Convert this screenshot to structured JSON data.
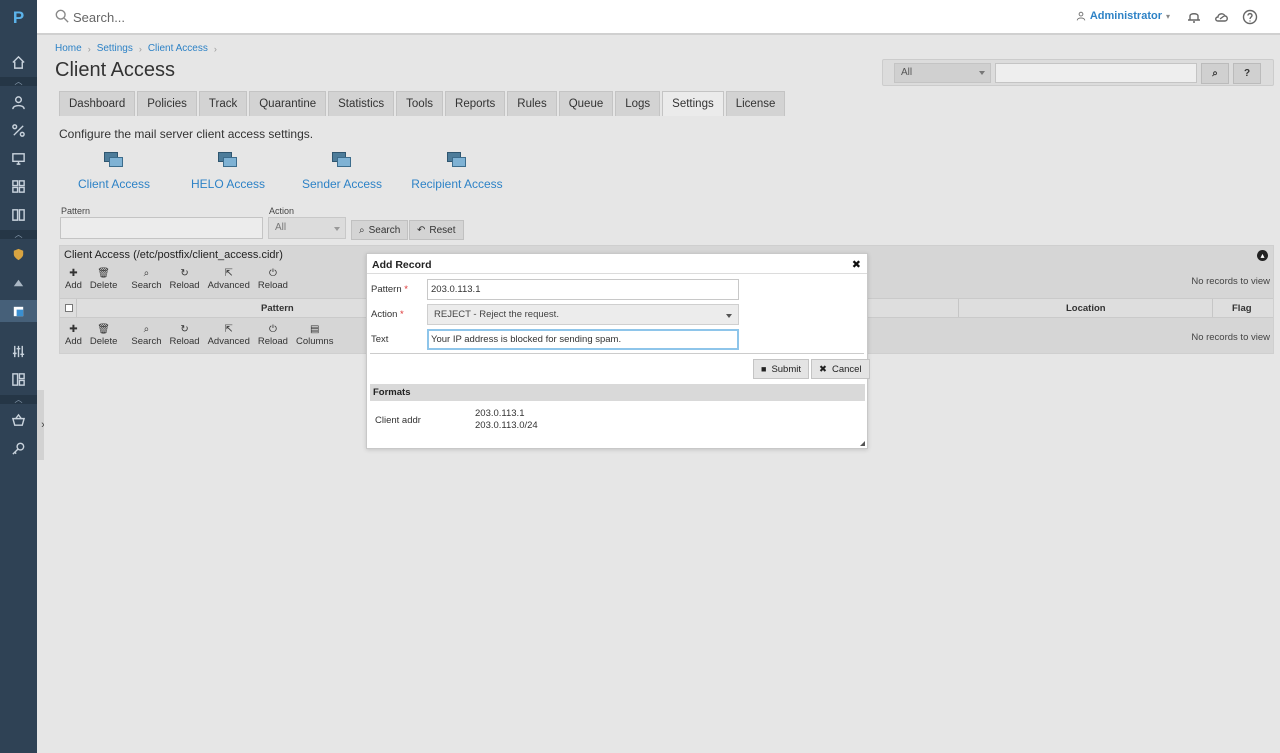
{
  "nav": {
    "logo": "P",
    "icons": [
      "home-icon",
      "user-icon",
      "percent-icon",
      "monitor-icon",
      "grid-icon",
      "book-icon",
      "shield-icon",
      "cloud-icon",
      "mail-shield-icon",
      "sliders-icon",
      "dashboard-icon",
      "basket-icon",
      "key-icon"
    ]
  },
  "topbar": {
    "search_placeholder": "Search...",
    "user": "Administrator"
  },
  "breadcrumb": [
    "Home",
    "Settings",
    "Client Access"
  ],
  "page_title": "Client Access",
  "filter": {
    "select_value": "All",
    "search_button": "⌕",
    "help_button": "?"
  },
  "tabs": [
    "Dashboard",
    "Policies",
    "Track",
    "Quarantine",
    "Statistics",
    "Tools",
    "Reports",
    "Rules",
    "Queue",
    "Logs",
    "Settings",
    "License"
  ],
  "active_tab": "Settings",
  "description": "Configure the mail server client access settings.",
  "access_items": [
    "Client Access",
    "HELO Access",
    "Sender Access",
    "Recipient Access"
  ],
  "search_form": {
    "pattern_label": "Pattern",
    "action_label": "Action",
    "action_value": "All",
    "search_button": "Search",
    "reset_button": "Reset"
  },
  "panel": {
    "title": "Client Access (/etc/postfix/client_access.cidr)",
    "toolbar1": [
      "Add",
      "Delete",
      "Search",
      "Reload",
      "Advanced",
      "Reload"
    ],
    "toolbar2": [
      "Add",
      "Delete",
      "Search",
      "Reload",
      "Advanced",
      "Reload",
      "Columns"
    ],
    "no_records": "No records to view",
    "columns": {
      "pattern": "Pattern",
      "location": "Location",
      "flag": "Flag"
    }
  },
  "dialog": {
    "title": "Add Record",
    "pattern_label": "Pattern",
    "pattern_value": "203.0.113.1",
    "action_label": "Action",
    "action_value": "REJECT - Reject the request.",
    "text_label": "Text",
    "text_value": "Your IP address is blocked for sending spam.",
    "submit": "Submit",
    "cancel": "Cancel",
    "formats_title": "Formats",
    "format_label": "Client addr",
    "format_values": [
      "203.0.113.1",
      "203.0.113.0/24"
    ]
  }
}
